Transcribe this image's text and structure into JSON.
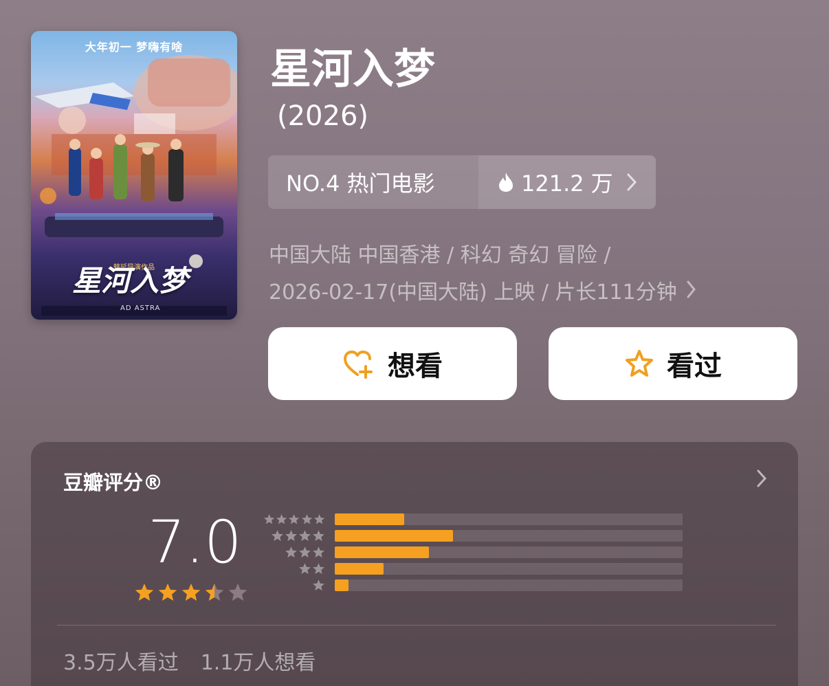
{
  "poster": {
    "tagline": "大年初一 梦嗨有啥",
    "title": "星河入梦",
    "director_line": "韩延导演作品",
    "english_title": "AD ASTRA"
  },
  "movie": {
    "title": "星河入梦",
    "year": "(2026)"
  },
  "rank": {
    "label": "NO.4 热门电影",
    "heat": "121.2 万"
  },
  "meta": {
    "line1": "中国大陆 中国香港 / 科幻 奇幻 冒险 /",
    "line2": "2026-02-17(中国大陆) 上映 / 片长111分钟"
  },
  "actions": {
    "want": "想看",
    "seen": "看过"
  },
  "rating": {
    "title": "豆瓣评分®",
    "score": "7.0",
    "stars": 3.5,
    "distribution": [
      {
        "stars": 5,
        "fraction": 0.2
      },
      {
        "stars": 4,
        "fraction": 0.34
      },
      {
        "stars": 3,
        "fraction": 0.27
      },
      {
        "stars": 2,
        "fraction": 0.14
      },
      {
        "stars": 1,
        "fraction": 0.04
      }
    ],
    "seen_count": "3.5万人看过",
    "want_count": "1.1万人想看"
  },
  "colors": {
    "accent": "#f5a020",
    "star_off": "#8a7c82"
  }
}
